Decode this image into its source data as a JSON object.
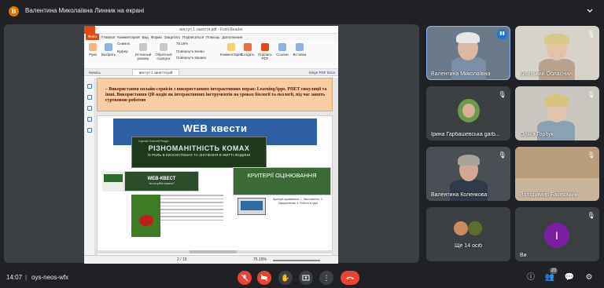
{
  "topbar": {
    "presenter_initial": "В",
    "presenter_text": "Валентина Миколаївна Линник на екрані"
  },
  "shared_doc": {
    "window_title": "виступ 1 заняття.pdf - Foxit Reader",
    "ribbon_tabs": [
      "Файл",
      "Главная",
      "Комментарий",
      "Вид",
      "Форма",
      "Защитить",
      "Подписаться",
      "Помощь",
      "Дополнения"
    ],
    "tools": [
      "Руки",
      "Выбрать",
      "Снимок",
      "Буфер",
      "Истинный размер",
      "Обратный порядок",
      "Повернуть влево",
      "Повернуть вправо",
      "Комментарий",
      "Создать",
      "Подпись PDF",
      "Ссылки",
      "Вставка"
    ],
    "zoom_value": "75.19%",
    "doc_tabs": [
      "Начать",
      "виступ 1 заняття.pdf"
    ],
    "esign_label": "eSign PDF Docs",
    "top_paragraph_highlight": "– Використання онлайн-сервісів з використанням інтерактивних вправ: LearningApps, PHET симуляції та інші.",
    "top_paragraph_rest": " Використання QR-кодів як інтерактивних інструментів на уроках біології та екології, під час занять гуртковою роботою",
    "web_banner": "WEB квести",
    "insect_header": "Єдиний Освітній Ресурс",
    "insect_title": "РІЗНОМАНІТНІСТЬ КОМАХ",
    "insect_subtitle": "ЇХ РОЛЬ В ЕКОСИСТЕМАХ ТА ЗНАЧЕННЯ В ЖИТТІ ЛЮДИНИ",
    "kvest_title": "WEB-КВЕСТ",
    "kvest_subtitle": "Чи потрібні комахи?",
    "criteria_title": "КРИТЕРІЇ ОЦІНЮВАННЯ",
    "criteria_text": "Критерії оцінювання: 1. Змістовність; 2. Оформлення; 3. Робота в групі",
    "page_indicator": "2 / 15",
    "zoom_footer": "75.19%"
  },
  "participants": [
    {
      "name": "Валентина Миколаївна",
      "speaking": true
    },
    {
      "name": "Київський Обласний",
      "speaking": false
    },
    {
      "name": "Ірина Гарбашевська garb...",
      "speaking": false
    },
    {
      "name": "Ольга Горбук",
      "speaking": false
    },
    {
      "name": "Валентина Коленкова",
      "speaking": false
    },
    {
      "name": "Володимир Баківський",
      "speaking": false
    },
    {
      "name": "Ще 14 осіб",
      "speaking": false
    },
    {
      "name": "Ви",
      "initial": "I",
      "speaking": false
    }
  ],
  "bottombar": {
    "time": "14:07",
    "meeting_code": "oys-neos-wfx",
    "participant_count": "23",
    "controls": [
      "mic-off",
      "camera-off",
      "raise-hand",
      "present",
      "more",
      "leave-call"
    ]
  },
  "colors": {
    "background": "#202124",
    "tile": "#3c4043",
    "danger": "#ea4335",
    "accent": "#1a73e8",
    "you_avatar": "#7b1fa2"
  }
}
